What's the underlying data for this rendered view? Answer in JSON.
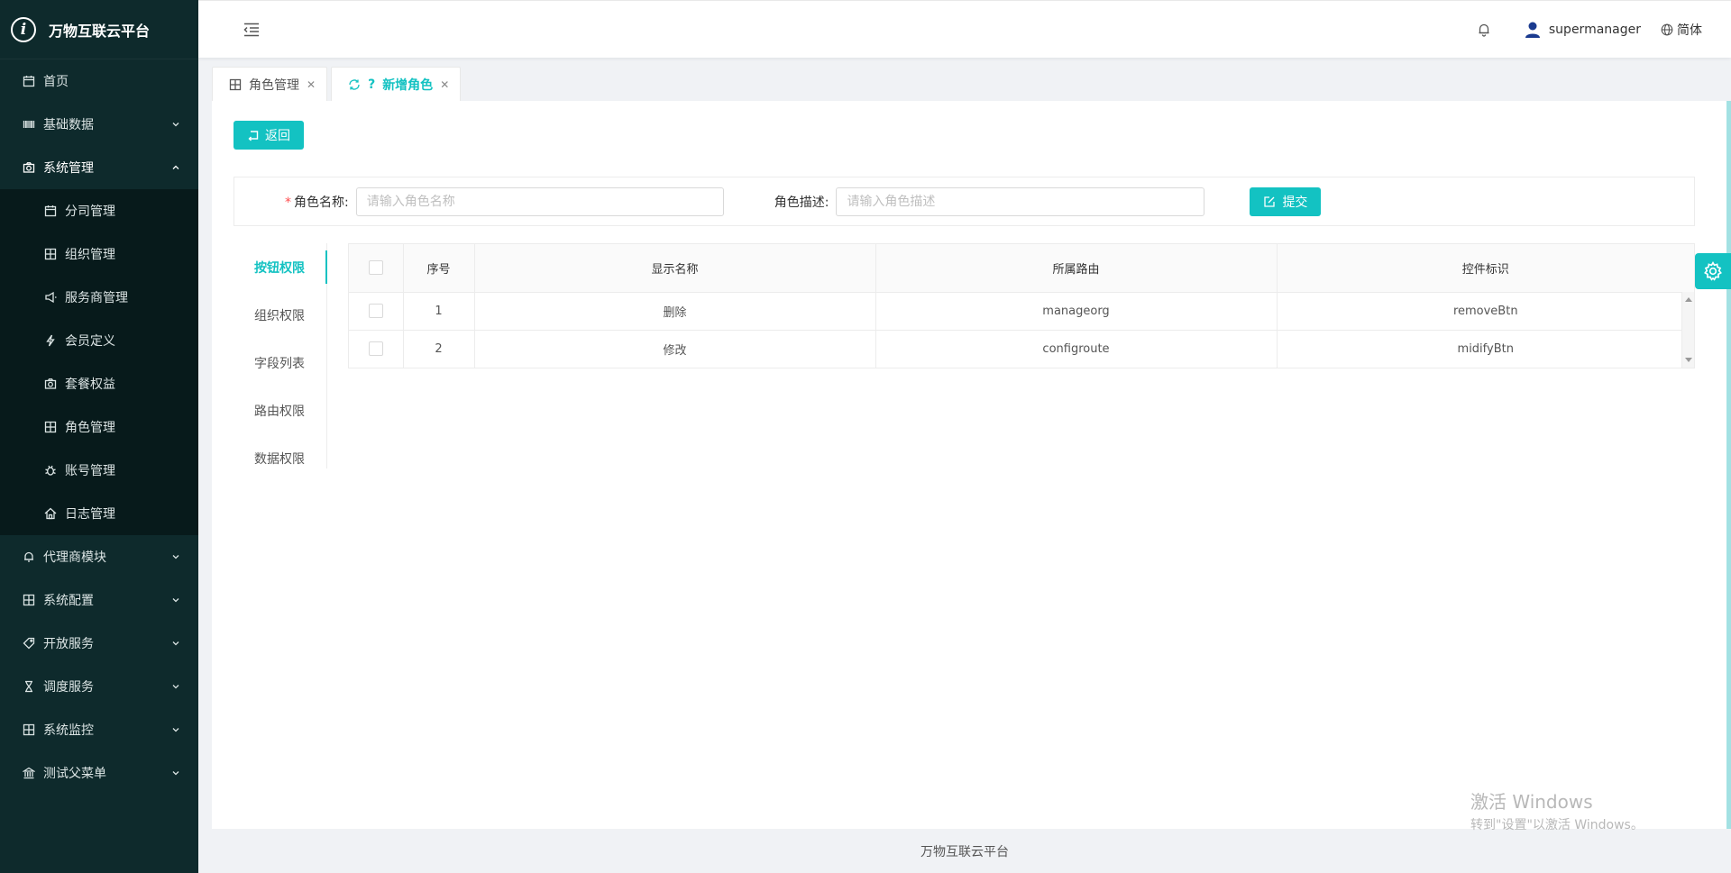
{
  "app": {
    "title": "万物互联云平台",
    "logo_letter": "i"
  },
  "sidebar": {
    "items": [
      {
        "label": "首页",
        "icon": "calendar-icon"
      },
      {
        "label": "基础数据",
        "icon": "barcode-icon",
        "has_arrow": true
      },
      {
        "label": "系统管理",
        "icon": "camera-icon",
        "has_arrow": true,
        "open": true,
        "children": [
          {
            "label": "分司管理",
            "icon": "calendar-icon"
          },
          {
            "label": "组织管理",
            "icon": "table-icon"
          },
          {
            "label": "服务商管理",
            "icon": "megaphone-icon"
          },
          {
            "label": "会员定义",
            "icon": "lightning-icon"
          },
          {
            "label": "套餐权益",
            "icon": "camera-icon"
          },
          {
            "label": "角色管理",
            "icon": "table-icon"
          },
          {
            "label": "账号管理",
            "icon": "bug-icon"
          },
          {
            "label": "日志管理",
            "icon": "home-icon"
          }
        ]
      },
      {
        "label": "代理商模块",
        "icon": "bell-icon",
        "has_arrow": true
      },
      {
        "label": "系统配置",
        "icon": "table-icon",
        "has_arrow": true
      },
      {
        "label": "开放服务",
        "icon": "tag-icon",
        "has_arrow": true
      },
      {
        "label": "调度服务",
        "icon": "hourglass-icon",
        "has_arrow": true
      },
      {
        "label": "系统监控",
        "icon": "table-icon",
        "has_arrow": true
      },
      {
        "label": "测试父菜单",
        "icon": "bank-icon",
        "has_arrow": true
      }
    ]
  },
  "header": {
    "username": "supermanager",
    "language": "简体"
  },
  "tabs": [
    {
      "label": "角色管理",
      "active": false
    },
    {
      "label": "新增角色",
      "prefix": "?",
      "active": true
    }
  ],
  "form": {
    "back_label": "返回",
    "role_name_label": "角色名称:",
    "role_name_required": "*",
    "role_name_placeholder": "请输入角色名称",
    "role_desc_label": "角色描述:",
    "role_desc_placeholder": "请输入角色描述",
    "submit_label": "提交"
  },
  "permission_tabs": [
    "按钮权限",
    "组织权限",
    "字段列表",
    "路由权限",
    "数据权限"
  ],
  "table": {
    "headers": [
      "序号",
      "显示名称",
      "所属路由",
      "控件标识"
    ],
    "rows": [
      {
        "index": "1",
        "name": "删除",
        "route": "manageorg",
        "control": "removeBtn"
      },
      {
        "index": "2",
        "name": "修改",
        "route": "configroute",
        "control": "midifyBtn"
      }
    ]
  },
  "watermark": {
    "title": "激活 Windows",
    "subtitle": "转到\"设置\"以激活 Windows。"
  },
  "footer": {
    "text": "万物互联云平台"
  },
  "colors": {
    "accent": "#13c2c2",
    "sidebar_bg": "#0e2a2c",
    "submenu_bg": "#071a1b"
  }
}
